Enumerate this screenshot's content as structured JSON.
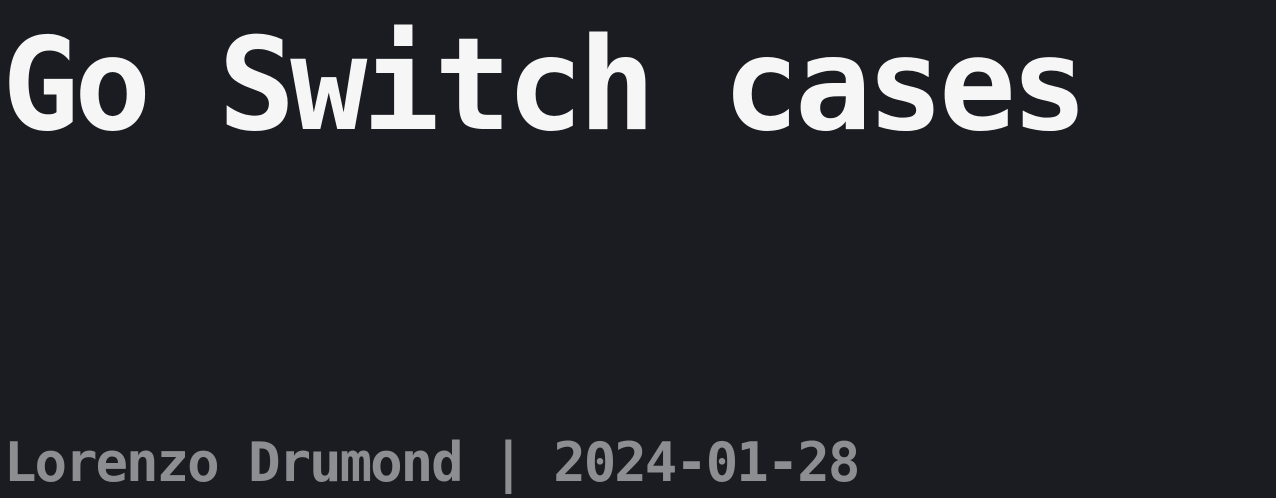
{
  "post": {
    "title": "Go Switch cases",
    "author": "Lorenzo Drumond",
    "separator": " | ",
    "date": "2024-01-28"
  },
  "colors": {
    "background": "#1b1c21",
    "title": "#f6f6f7",
    "meta": "#8d8e92"
  }
}
